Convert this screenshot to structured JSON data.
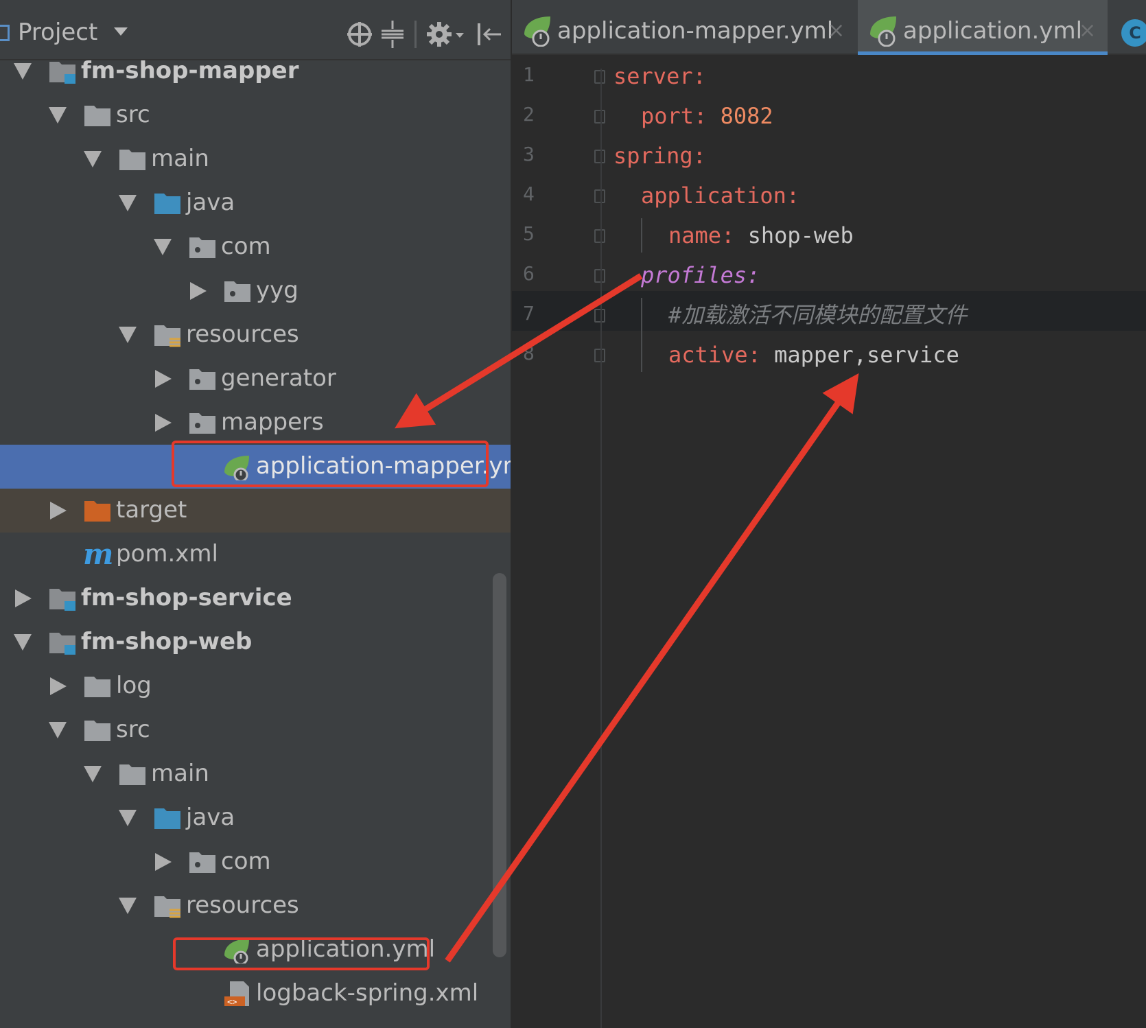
{
  "project_panel": {
    "title": "Project",
    "tools": [
      "locate-icon",
      "collapse-all-icon",
      "gear-icon",
      "hide-panel-icon"
    ],
    "tree": [
      {
        "label": "fm-shop-mapper",
        "kind": "module",
        "state": "open"
      },
      {
        "label": "src",
        "kind": "folder",
        "state": "open"
      },
      {
        "label": "main",
        "kind": "folder",
        "state": "open"
      },
      {
        "label": "java",
        "kind": "source-folder",
        "state": "open"
      },
      {
        "label": "com",
        "kind": "package",
        "state": "open"
      },
      {
        "label": "yyg",
        "kind": "package",
        "state": "closed"
      },
      {
        "label": "resources",
        "kind": "resources-folder",
        "state": "open"
      },
      {
        "label": "generator",
        "kind": "package",
        "state": "closed"
      },
      {
        "label": "mappers",
        "kind": "package",
        "state": "closed"
      },
      {
        "label": "application-mapper.yml",
        "kind": "spring-yml",
        "state": "none",
        "selected": true
      },
      {
        "label": "target",
        "kind": "excluded-folder",
        "state": "closed"
      },
      {
        "label": "pom.xml",
        "kind": "maven",
        "state": "none"
      },
      {
        "label": "fm-shop-service",
        "kind": "module",
        "state": "closed"
      },
      {
        "label": "fm-shop-web",
        "kind": "module",
        "state": "open"
      },
      {
        "label": "log",
        "kind": "folder",
        "state": "closed"
      },
      {
        "label": "src",
        "kind": "folder",
        "state": "open"
      },
      {
        "label": "main",
        "kind": "folder",
        "state": "open"
      },
      {
        "label": "java",
        "kind": "source-folder",
        "state": "open"
      },
      {
        "label": "com",
        "kind": "package",
        "state": "closed"
      },
      {
        "label": "resources",
        "kind": "resources-folder",
        "state": "open"
      },
      {
        "label": "application.yml",
        "kind": "spring-yml",
        "state": "none"
      },
      {
        "label": "logback-spring.xml",
        "kind": "xml",
        "state": "none"
      }
    ]
  },
  "editor": {
    "tabs": [
      {
        "label": "application-mapper.yml",
        "close": "×",
        "active": false
      },
      {
        "label": "application.yml",
        "close": "×",
        "active": true
      }
    ],
    "extra_tab_icon": "C",
    "lines": [
      {
        "no": "1",
        "key": "server:",
        "value": ""
      },
      {
        "no": "2",
        "key": "port:",
        "value": " 8082"
      },
      {
        "no": "3",
        "key": "spring:",
        "value": ""
      },
      {
        "no": "4",
        "key": "application:",
        "value": ""
      },
      {
        "no": "5",
        "key": "name:",
        "value": " shop-web"
      },
      {
        "no": "6",
        "key": "profiles:",
        "value": ""
      },
      {
        "no": "7",
        "key": "",
        "value": "#加载激活不同模块的配置文件"
      },
      {
        "no": "8",
        "key": "active:",
        "value": " mapper,service"
      }
    ]
  },
  "colors": {
    "annotation": "#e5392b",
    "selection": "#4b6eaf",
    "yaml_key": "#e46a5e",
    "spring_green": "#6aa84f"
  }
}
